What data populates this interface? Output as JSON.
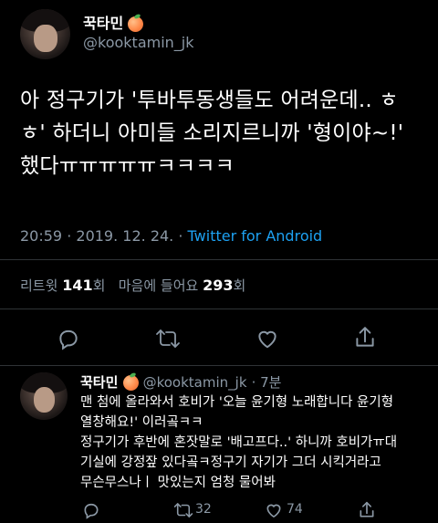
{
  "tweet": {
    "author_name": "꾹타민",
    "author_handle": "@kooktamin_jk",
    "text_lines": [
      "아 정구기가 '투바투동생들도 어려운데.. ㅎ",
      "ㅎ' 하더니 아미들 소리지르니까 '형이야~!'",
      "했다ㅠㅠㅠㅠㅠㅋㅋㅋㅋ"
    ],
    "time": "20:59",
    "date": "2019. 12. 24.",
    "separator": "·",
    "source": "Twitter for Android",
    "retweets_label": "리트윗",
    "retweets_count": "141",
    "retweets_unit": "회",
    "likes_label": "마음에 들어요",
    "likes_count": "293",
    "likes_unit": "회"
  },
  "actions": {
    "icons": [
      "reply-icon",
      "retweet-icon",
      "like-icon",
      "share-icon"
    ]
  },
  "reply": {
    "author_name": "꾹타민",
    "author_handle": "@kooktamin_jk",
    "time_ago": "· 7분",
    "text_lines": [
      "맨 첨에 올라와서 호비가 '오늘 윤기형 노래합니다 윤기형",
      "열창해요!' 이러곸ㅋㅋ",
      "정구기가 후반에 혼잣말로 '배고프다..' 하니까 호비가ㅠ대",
      "기실에 강정잪 있다곸ㅋ정구기 자기가 그더 시킥거라고",
      "무슨무스나ㅣ 맛있는지 엄청 물어봐"
    ],
    "retweet_count": "32",
    "like_count": "74"
  },
  "colors": {
    "background": "#000000",
    "text": "#ffffff",
    "muted": "#8b98a5",
    "link": "#1da1f2",
    "divider": "#2f3336"
  }
}
